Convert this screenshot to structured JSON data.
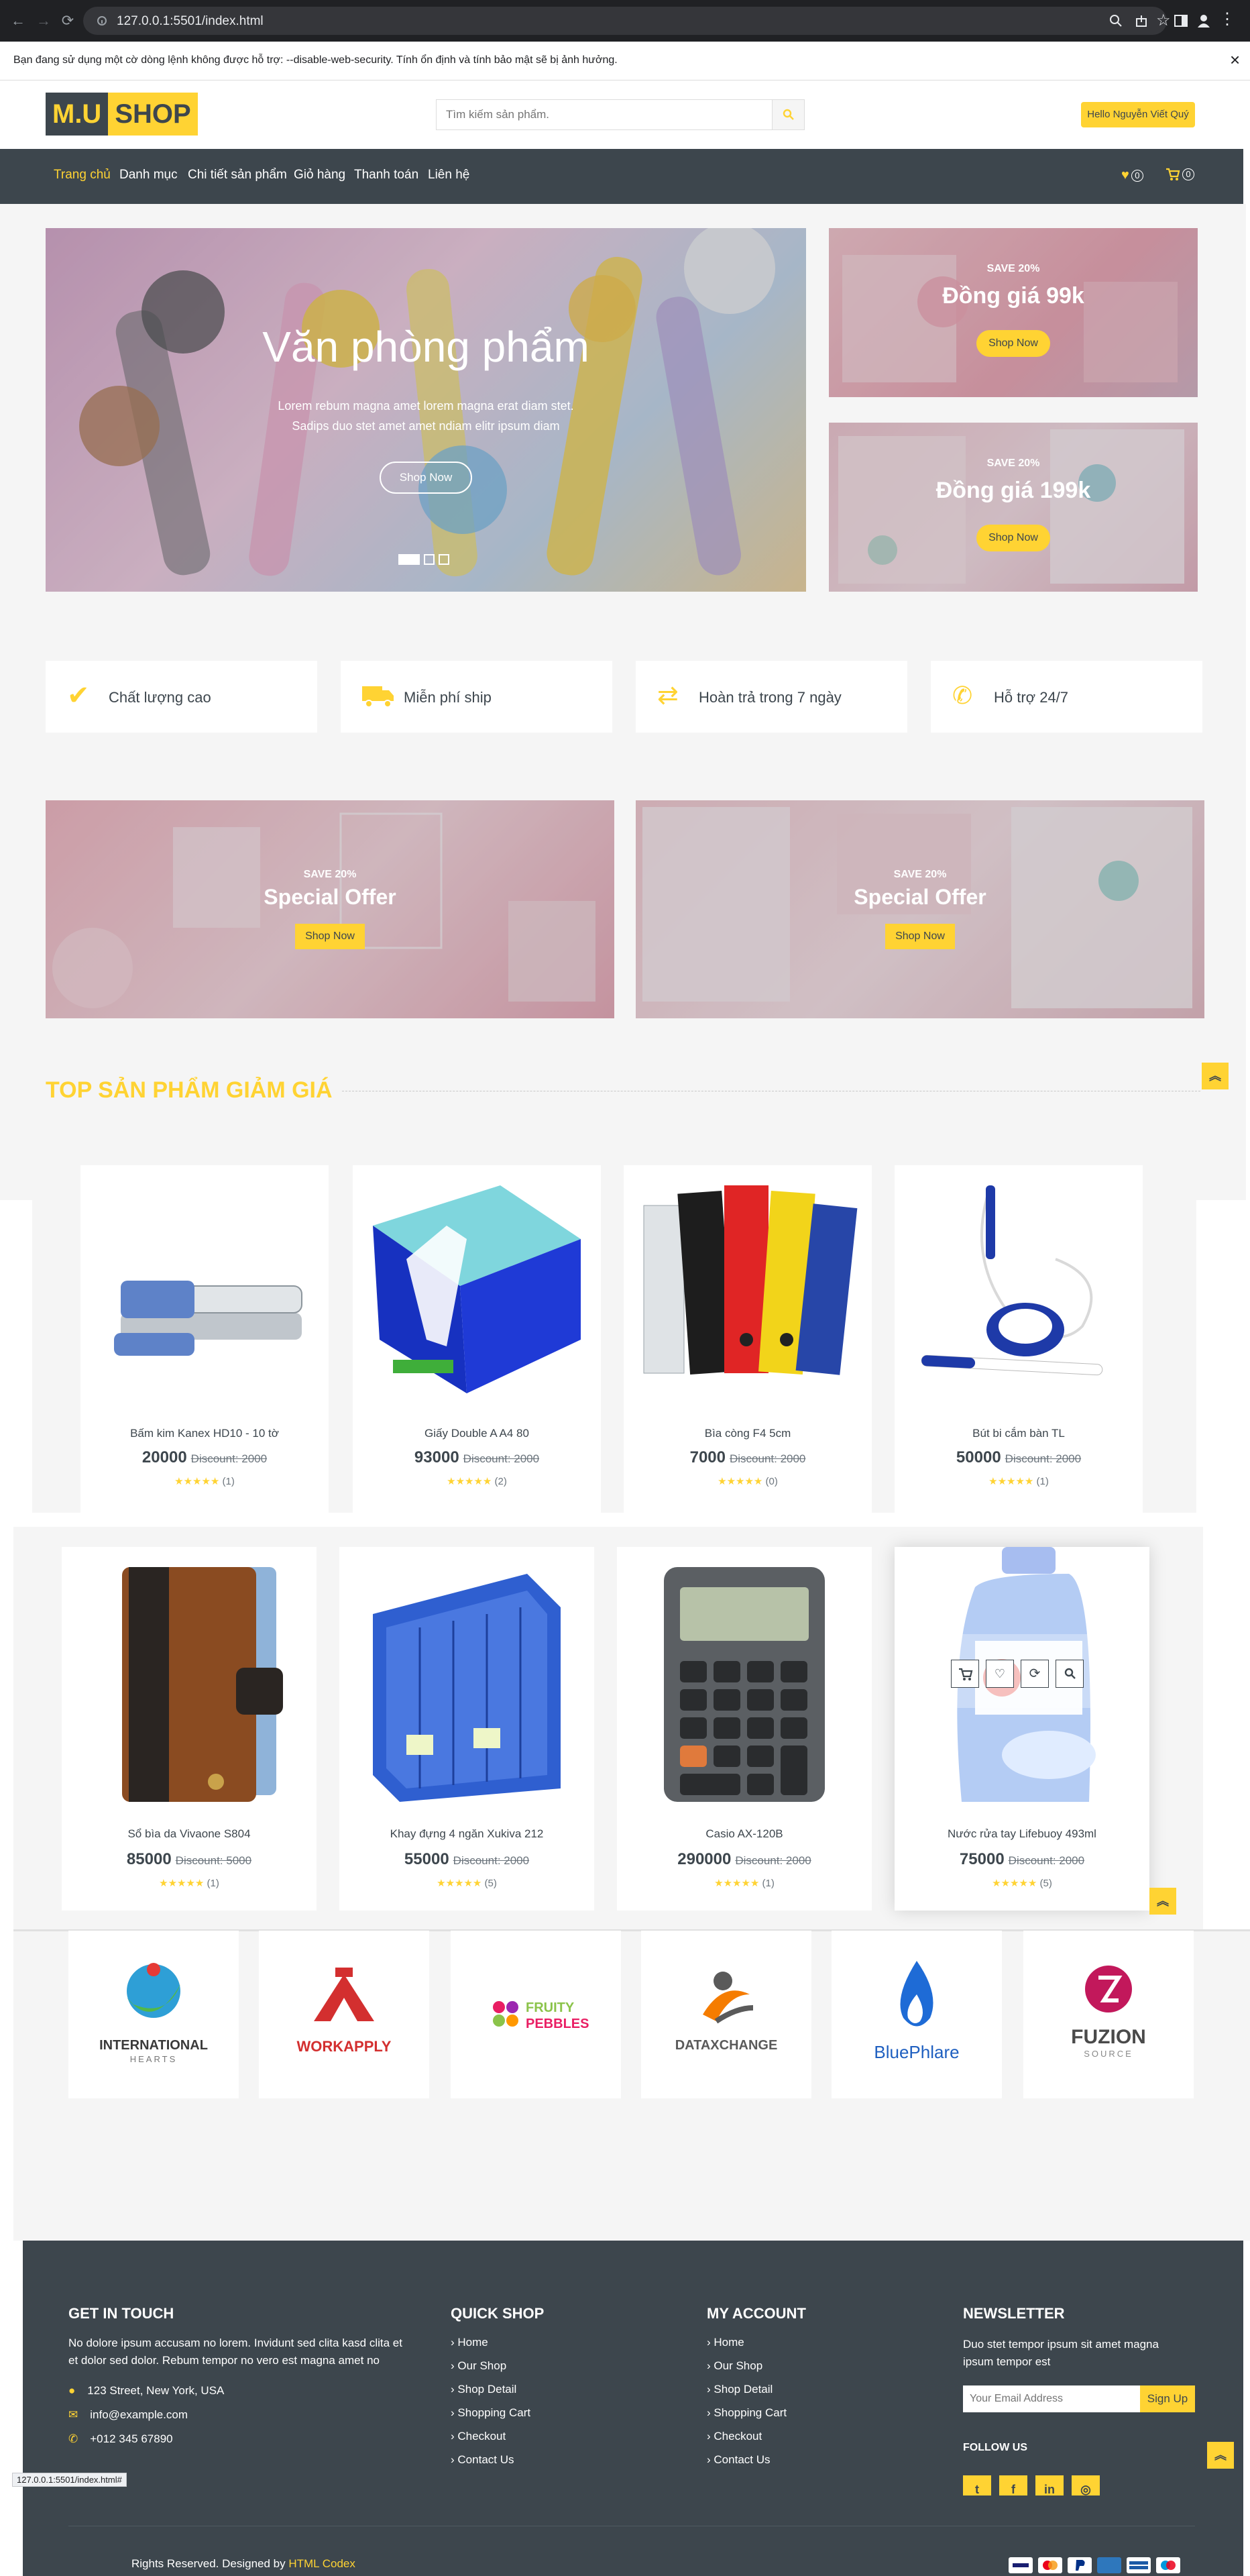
{
  "browser": {
    "url": "127.0.0.1:5501/index.html",
    "status_url": "127.0.0.1:5501/index.html#",
    "infobar_text": "Bạn đang sử dụng một cờ dòng lệnh không được hỗ trợ: --disable-web-security. Tính ổn định và tính bảo mật sẽ bị ảnh hưởng.",
    "close_label": "×"
  },
  "header": {
    "logo_left": "M.U",
    "logo_right": "SHOP",
    "search_placeholder": "Tìm kiếm sản phẩm.",
    "greeting": "Hello Nguyễn Viết Quý"
  },
  "nav": {
    "items": [
      "Trang chủ",
      "Danh mục",
      "Chi tiết sản phẩm",
      "Giỏ hàng",
      "Thanh toán",
      "Liên hệ"
    ],
    "wishlist_count": "0",
    "cart_count": "0"
  },
  "hero": {
    "title": "Văn phòng phẩm",
    "text": "Lorem rebum magna amet lorem magna erat diam stet. Sadips duo stet amet amet ndiam elitr ipsum diam",
    "button": "Shop Now",
    "side_offers": [
      {
        "save": "SAVE 20%",
        "title": "Đồng giá 99k",
        "button": "Shop Now"
      },
      {
        "save": "SAVE 20%",
        "title": "Đồng giá 199k",
        "button": "Shop Now"
      }
    ]
  },
  "features": [
    "Chất lượng cao",
    "Miễn phí ship",
    "Hoàn trả trong 7 ngày",
    "Hỗ trợ 24/7"
  ],
  "offers": [
    {
      "save": "SAVE 20%",
      "title": "Special Offer",
      "button": "Shop Now"
    },
    {
      "save": "SAVE 20%",
      "title": "Special Offer",
      "button": "Shop Now"
    }
  ],
  "section_title": "TOP SẢN PHẨM GIẢM GIÁ",
  "products": [
    {
      "name": "Bấm kim Kanex HD10 - 10 tờ",
      "price": "20000",
      "discount": "Discount: 2000",
      "rating": "(1)"
    },
    {
      "name": "Giấy Double A A4 80",
      "price": "93000",
      "discount": "Discount: 2000",
      "rating": "(2)"
    },
    {
      "name": "Bìa còng F4 5cm",
      "price": "7000",
      "discount": "Discount: 2000",
      "rating": "(0)"
    },
    {
      "name": "Bút bi cắm bàn TL",
      "price": "50000",
      "discount": "Discount: 2000",
      "rating": "(1)"
    },
    {
      "name": "Sổ bìa da Vivaone S804",
      "price": "85000",
      "discount": "Discount: 5000",
      "rating": "(1)"
    },
    {
      "name": "Khay đựng 4 ngăn Xukiva 212",
      "price": "55000",
      "discount": "Discount: 2000",
      "rating": "(5)"
    },
    {
      "name": "Casio AX-120B",
      "price": "290000",
      "discount": "Discount: 2000",
      "rating": "(1)"
    },
    {
      "name": "Nước rửa tay Lifebuoy 493ml",
      "price": "75000",
      "discount": "Discount: 2000",
      "rating": "(5)"
    }
  ],
  "vendors": [
    {
      "line1": "INTERNATIONAL",
      "line2": "HEARTS"
    },
    {
      "line1": "WORKAPPLY",
      "line2": ""
    },
    {
      "line1": "FRUITY",
      "line2": "PEBBLES"
    },
    {
      "line1": "DATAXCHANGE",
      "line2": ""
    },
    {
      "line1": "BluePhlare",
      "line2": ""
    },
    {
      "line1": "FUZION",
      "line2": "SOURCE"
    }
  ],
  "footer": {
    "get_in_touch": "GET IN TOUCH",
    "about": "No dolore ipsum accusam no lorem. Invidunt sed clita kasd clita et et dolor sed dolor. Rebum tempor no vero est magna amet no",
    "address": "123 Street, New York, USA",
    "email": "info@example.com",
    "phone": "+012 345 67890",
    "quick_shop": "QUICK SHOP",
    "my_account": "MY ACCOUNT",
    "links": [
      "Home",
      "Our Shop",
      "Shop Detail",
      "Shopping Cart",
      "Checkout",
      "Contact Us"
    ],
    "newsletter": "NEWSLETTER",
    "newsletter_text": "Duo stet tempor ipsum sit amet magna ipsum tempor est",
    "email_placeholder": "Your Email Address",
    "signup": "Sign Up",
    "follow": "FOLLOW US",
    "copyright": "Rights Reserved. Designed by",
    "designer": "HTML Codex"
  },
  "colors": {
    "accent": "#ffd333",
    "dark": "#3d464d",
    "light": "#f5f5f5"
  },
  "icons": {
    "top_button": "double-chevron-up-icon"
  }
}
